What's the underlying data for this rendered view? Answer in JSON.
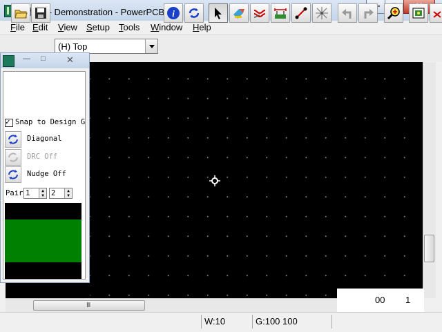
{
  "window": {
    "title": "无标题 - Demonstration - PowerPCB",
    "min_glyph": "—",
    "max_glyph": "□",
    "close_glyph": "✕"
  },
  "menu": [
    "File",
    "Edit",
    "View",
    "Setup",
    "Tools",
    "Window",
    "Help"
  ],
  "menu_mnemonics": [
    "F",
    "E",
    "V",
    "S",
    "T",
    "W",
    "H"
  ],
  "toolbar": {
    "layer_value": "(H) Top",
    "icons": [
      "open-folder-icon",
      "save-icon",
      "info-icon",
      "refresh-icon",
      "select-arrow-icon",
      "drafting-icon",
      "route-icon",
      "dimension-icon",
      "ecO-icon",
      "autoroute-icon",
      "undo-icon",
      "redo-icon",
      "zoom-icon",
      "view-icon"
    ]
  },
  "palette": {
    "snap_label": "Snap to Design G",
    "diagonal_label": "Diagonal",
    "drc_label": "DRC Off",
    "nudge_label": "Nudge Off",
    "pair_label": "Pair",
    "pair_value_1": "1",
    "pair_value_2": "2",
    "colors": {
      "layer": "#008000",
      "background": "#000000"
    }
  },
  "canvas": {
    "coord_readout": "00",
    "coord_mark": "1"
  },
  "status": {
    "width": "W:10",
    "grid": "G:100 100"
  }
}
